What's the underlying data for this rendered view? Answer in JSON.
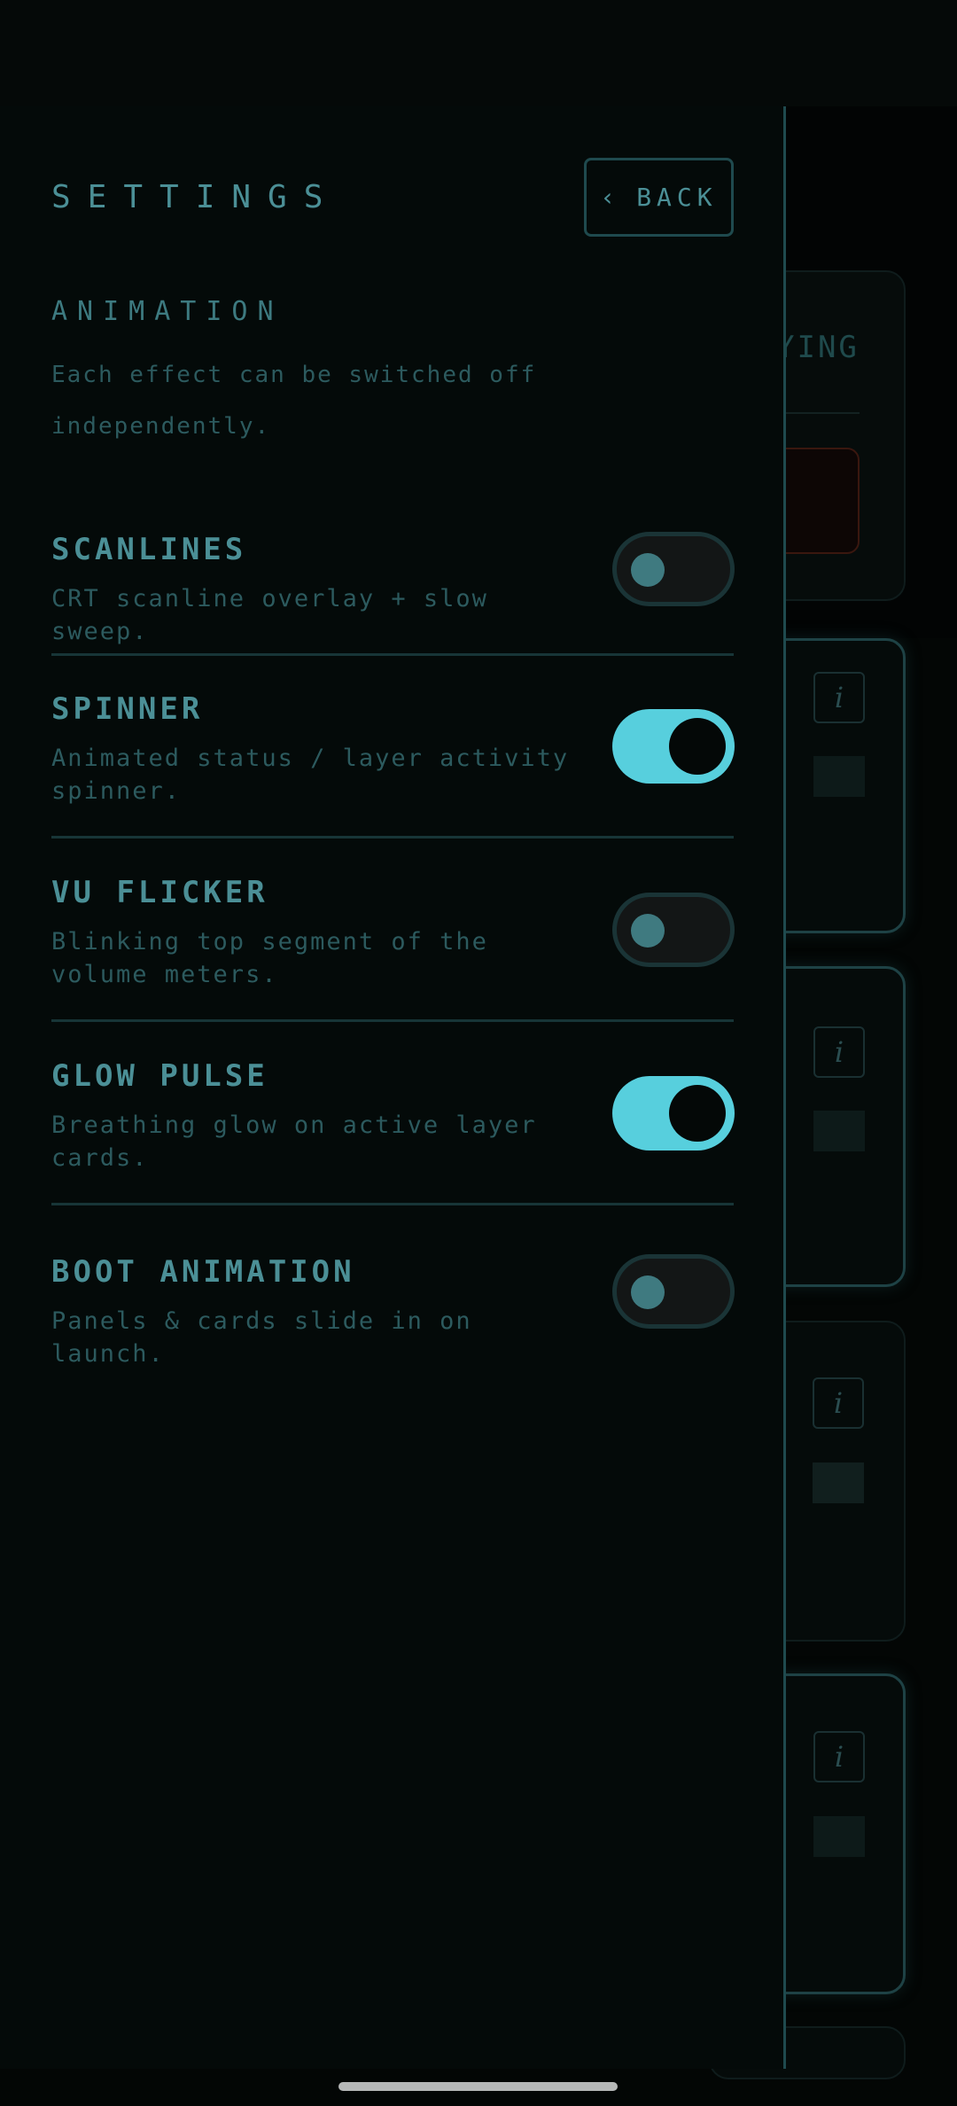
{
  "settings": {
    "title": "SETTINGS",
    "back_label": "BACK",
    "section": {
      "label": "ANIMATION",
      "description": "Each effect can be switched off independently."
    },
    "items": [
      {
        "title": "SCANLINES",
        "description": "CRT scanline overlay + slow sweep.",
        "enabled": false
      },
      {
        "title": "SPINNER",
        "description": "Animated status / layer activity spinner.",
        "enabled": true
      },
      {
        "title": "VU FLICKER",
        "description": "Blinking top segment of the volume meters.",
        "enabled": false
      },
      {
        "title": "GLOW PULSE",
        "description": "Breathing glow on active layer cards.",
        "enabled": true
      },
      {
        "title": "BOOT ANIMATION",
        "description": "Panels & cards slide in on launch.",
        "enabled": false
      }
    ]
  },
  "background": {
    "now_label_partial": "YING",
    "info_glyph": "i"
  },
  "icons": {
    "back": "chevron-left-icon",
    "info": "info-icon"
  },
  "colors": {
    "accent": "#57cfdd",
    "text": "#4b8f96",
    "muted": "#2c5a5e",
    "panel_bg": "#040a09",
    "border": "#1f4a4e"
  }
}
